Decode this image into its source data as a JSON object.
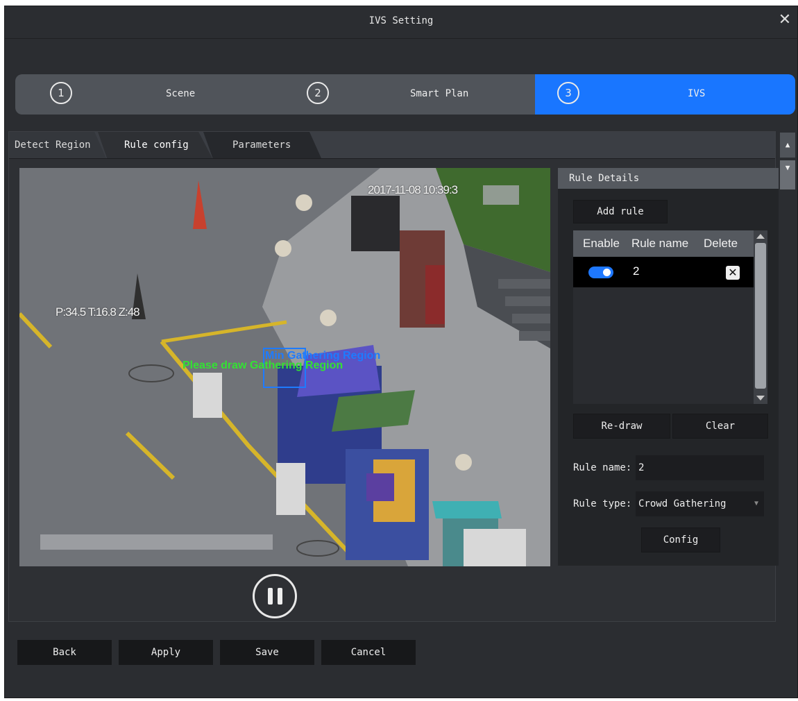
{
  "window": {
    "title": "IVS Setting",
    "close_icon": "close-icon"
  },
  "steps": [
    {
      "number": "1",
      "label": "Scene",
      "active": false
    },
    {
      "number": "2",
      "label": "Smart Plan",
      "active": false
    },
    {
      "number": "3",
      "label": "IVS",
      "active": true
    }
  ],
  "tabs": [
    "Detect Region",
    "Rule config",
    "Parameters"
  ],
  "video": {
    "timestamp": "2017-11-08 10:39:3",
    "ptz": "P:34.5 T:16.8 Z:48",
    "overlay_blue": "Min Gathering Region",
    "overlay_green": "Please draw Gathering Region"
  },
  "rule_panel": {
    "heading": "Rule Details",
    "add_rule": "Add rule",
    "table": {
      "headers": [
        "Enable",
        "Rule name",
        "Delete"
      ],
      "rows": [
        {
          "enabled": true,
          "name": "2"
        }
      ]
    },
    "redraw": "Re-draw",
    "clear": "Clear",
    "rule_name_label": "Rule name:",
    "rule_name_value": "2",
    "rule_type_label": "Rule type:",
    "rule_type_value": "Crowd Gathering",
    "config": "Config"
  },
  "footer": {
    "back": "Back",
    "apply": "Apply",
    "save": "Save",
    "cancel": "Cancel"
  },
  "colors": {
    "accent": "#1976ff",
    "bg": "#2b2d31"
  }
}
